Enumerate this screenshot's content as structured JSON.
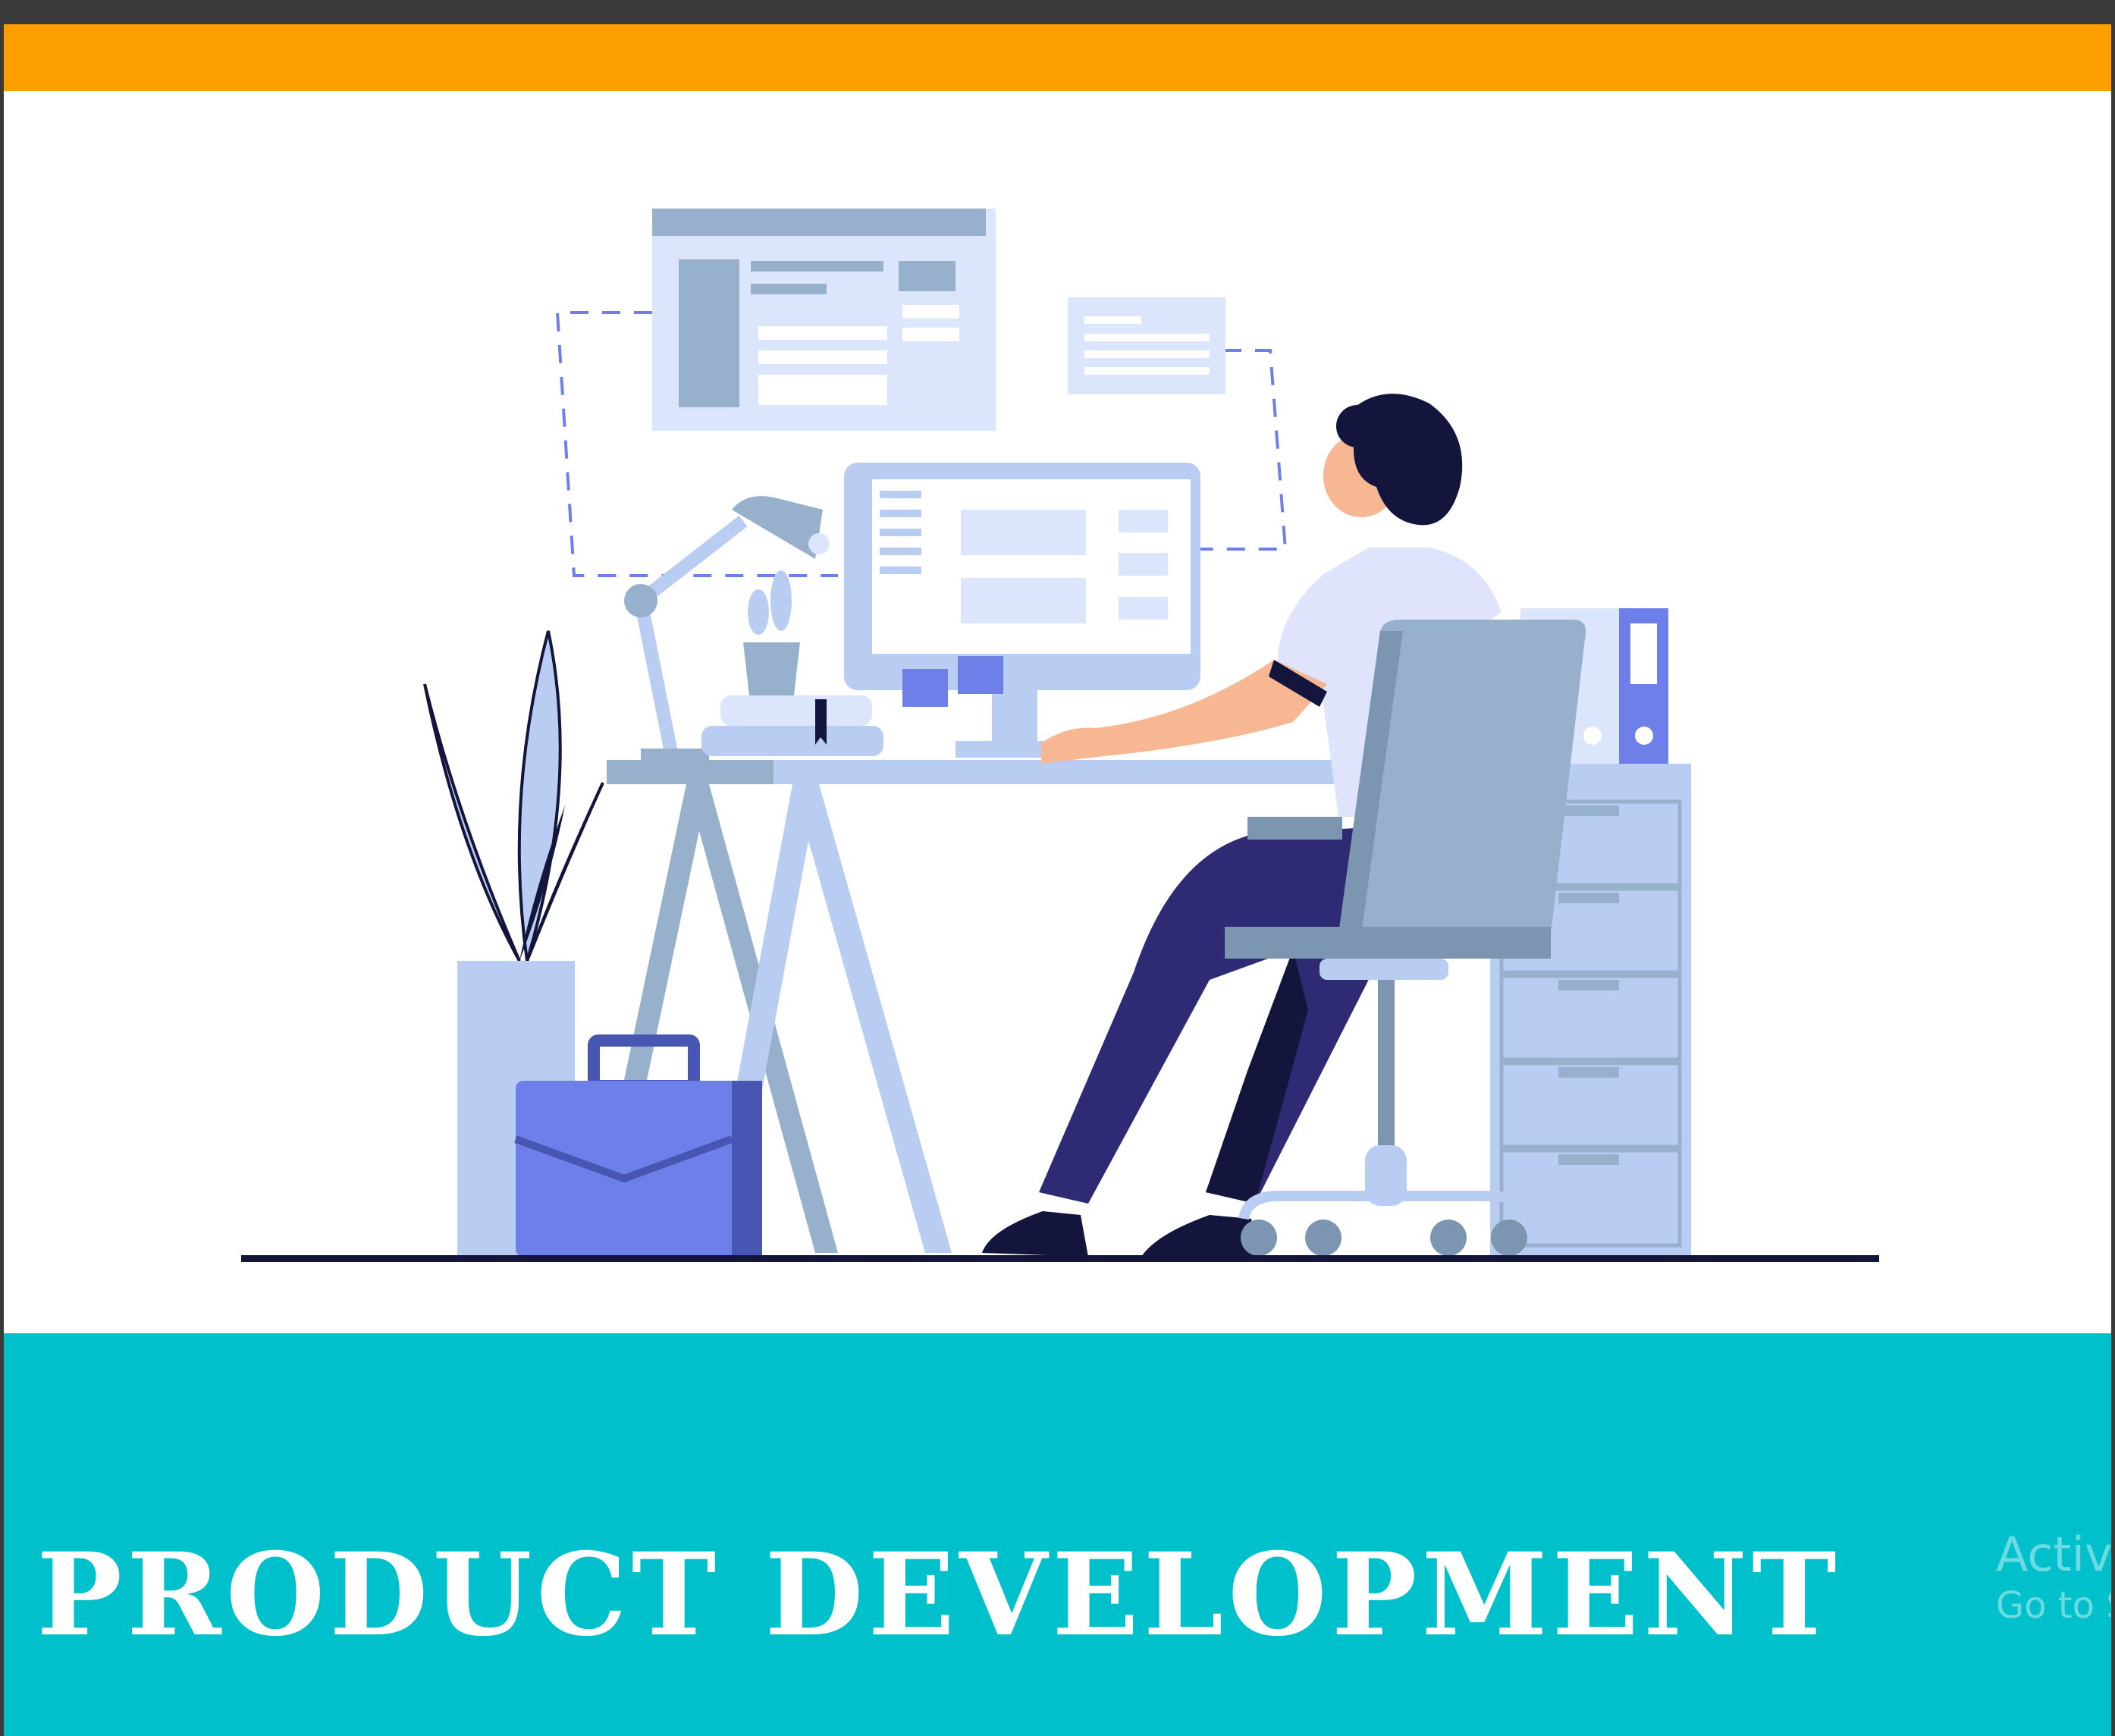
{
  "banner": {
    "title": "PRODUCT DEVELOPMENT"
  },
  "watermark": {
    "line1": "Activ",
    "line2": "Go to S"
  },
  "colors": {
    "orange": "#fd9f00",
    "teal": "#00c0cb",
    "navy": "#14153d",
    "periwinkle": "#6f7fe9",
    "light_blue": "#b9cdf3",
    "grey_blue": "#97b1cd"
  },
  "icons": [
    "monitor-icon",
    "desk-lamp-icon",
    "potted-plant-icon",
    "briefcase-icon",
    "office-chair-icon",
    "binder-icon",
    "filing-cabinet-icon"
  ]
}
